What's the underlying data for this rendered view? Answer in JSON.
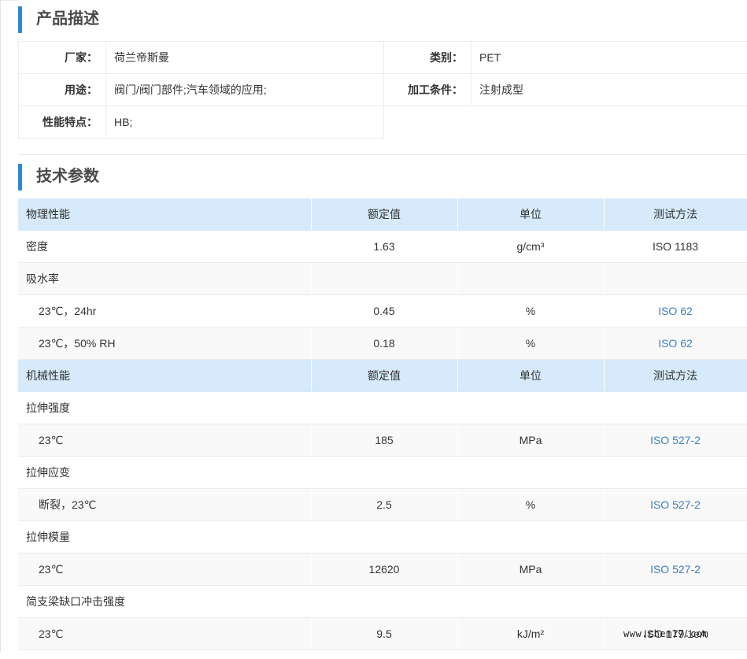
{
  "description": {
    "title": "产品描述",
    "rows": [
      {
        "k1": "厂家：",
        "v1": "荷兰帝斯曼",
        "k2": "类别：",
        "v2": "PET"
      },
      {
        "k1": "用途：",
        "v1": "阀门/阀门部件;汽车领域的应用;",
        "k2": "加工条件：",
        "v2": "注射成型"
      },
      {
        "k1": "性能特点：",
        "v1": "HB;"
      }
    ]
  },
  "tech": {
    "title": "技术参数",
    "physical_header": {
      "group": "物理性能",
      "rated": "额定值",
      "unit": "单位",
      "method": "测试方法"
    },
    "physical_rows": [
      {
        "name": "密度",
        "value": "1.63",
        "unit": "g/cm³",
        "method": "ISO 1183"
      },
      {
        "name": "吸水率",
        "value": "",
        "unit": "",
        "method": ""
      },
      {
        "name": "23℃，24hr",
        "value": "0.45",
        "unit": "%",
        "method": "ISO 62"
      },
      {
        "name": "23℃，50% RH",
        "value": "0.18",
        "unit": "%",
        "method": "ISO 62"
      }
    ],
    "mechanical_header": {
      "group": "机械性能",
      "rated": "额定值",
      "unit": "单位",
      "method": "测试方法"
    },
    "mechanical_rows": [
      {
        "name": "拉伸强度",
        "value": "",
        "unit": "",
        "method": ""
      },
      {
        "name": "23℃",
        "value": "185",
        "unit": "MPa",
        "method": "ISO 527-2"
      },
      {
        "name": "拉伸应变",
        "value": "",
        "unit": "",
        "method": ""
      },
      {
        "name": "断裂，23℃",
        "value": "2.5",
        "unit": "%",
        "method": "ISO 527-2"
      },
      {
        "name": "拉伸模量",
        "value": "",
        "unit": "",
        "method": ""
      },
      {
        "name": "23℃",
        "value": "12620",
        "unit": "MPa",
        "method": "ISO 527-2"
      },
      {
        "name": "简支梁缺口冲击强度",
        "value": "",
        "unit": "",
        "method": ""
      },
      {
        "name": "23℃",
        "value": "9.5",
        "unit": "kJ/m²",
        "method": "ISO 179/1eA"
      }
    ]
  },
  "watermark": "www.chem17.com",
  "colors": {
    "accent": "#2f86d6",
    "header_bg": "#d6eafb",
    "link": "#3a7fc1"
  }
}
